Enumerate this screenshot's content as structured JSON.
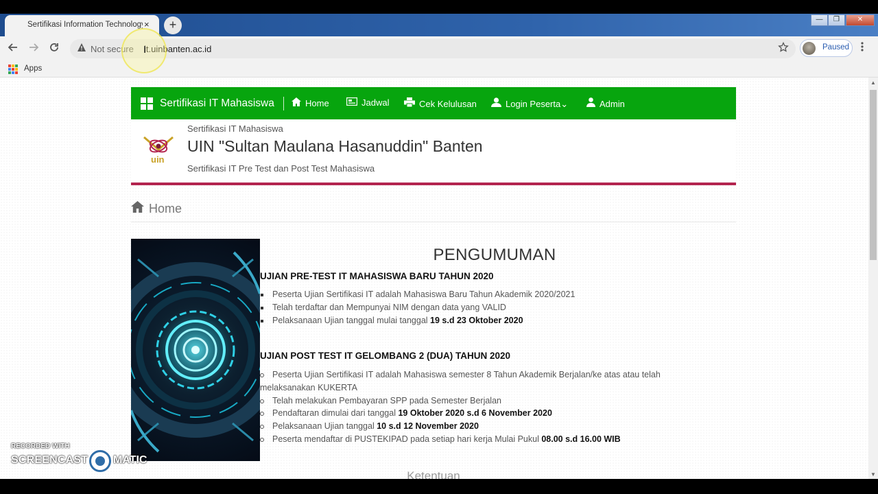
{
  "browser": {
    "tab_title": "Sertifikasi Information Technology",
    "tab_close": "×",
    "new_tab": "+",
    "not_secure": "Not secure",
    "url": "it.uinbanten.ac.id",
    "profile_status": "Paused",
    "bookmarks": {
      "apps": "Apps"
    },
    "window_controls": {
      "minimize": "—",
      "restore": "❐",
      "close": "✕"
    },
    "icons": {
      "back": "arrow-left",
      "forward": "arrow-right",
      "reload": "reload",
      "warning": "warning-triangle",
      "star": "star",
      "menu": "three-dots"
    }
  },
  "site": {
    "nav": {
      "brand": "Sertifikasi IT Mahasiswa",
      "items": [
        {
          "label": "Home",
          "icon": "home-icon"
        },
        {
          "label": "Jadwal",
          "icon": "card-icon"
        },
        {
          "label": "Cek Kelulusan",
          "icon": "printer-icon"
        },
        {
          "label": "Login Peserta⌄",
          "icon": "user-icon"
        },
        {
          "label": "Admin",
          "icon": "admin-icon"
        }
      ]
    },
    "header": {
      "kicker": "Sertifikasi IT Mahasiswa",
      "title": "UIN \"Sultan Maulana Hasanuddin\" Banten",
      "tagline": "Sertifikasi IT Pre Test dan Post Test Mahasiswa",
      "logo_text": "uin"
    },
    "breadcrumb": "Home",
    "announcement": {
      "heading": "PENGUMUMAN",
      "pretest": {
        "title": "UJIAN PRE-TEST IT MAHASISWA BARU TAHUN 2020",
        "b1": "Peserta Ujian Sertifikasi IT adalah Mahasiswa Baru Tahun Akademik 2020/2021",
        "b2": "Telah terdaftar dan Mempunyai NIM dengan data yang VALID",
        "b3_text": "Pelaksanaan Ujian tanggal mulai tanggal ",
        "b3_bold": "19 s.d 23 Oktober 2020"
      },
      "posttest": {
        "title": "UJIAN POST TEST IT GELOMBANG 2 (DUA) TAHUN 2020",
        "b1": "Peserta Ujian Sertifikasi IT adalah Mahasiswa semester 8 Tahun Akademik Berjalan/ke atas atau telah melaksanakan KUKERTA",
        "b2": "Telah melakukan Pembayaran SPP pada Semester Berjalan",
        "b3_text": "Pendaftaran dimulai dari tanggal ",
        "b3_bold": "19 Oktober 2020 s.d 6 November 2020",
        "b4_text": "Pelaksanaan Ujian tanggal ",
        "b4_bold": "10 s.d 12 November 2020",
        "b5_text": "Peserta mendaftar di PUSTEKIPAD pada setiap hari kerja Mulai Pukul ",
        "b5_bold": "08.00 s.d 16.00 WIB"
      },
      "next_heading": "Ketentuan"
    }
  },
  "watermark": {
    "recorded": "RECORDED WITH",
    "brand_a": "SCREENCAST",
    "brand_b": "MATIC"
  },
  "colors": {
    "nav_green": "#07a50e",
    "header_rule": "#b3244e",
    "tab_strip": "#2f63ab"
  }
}
